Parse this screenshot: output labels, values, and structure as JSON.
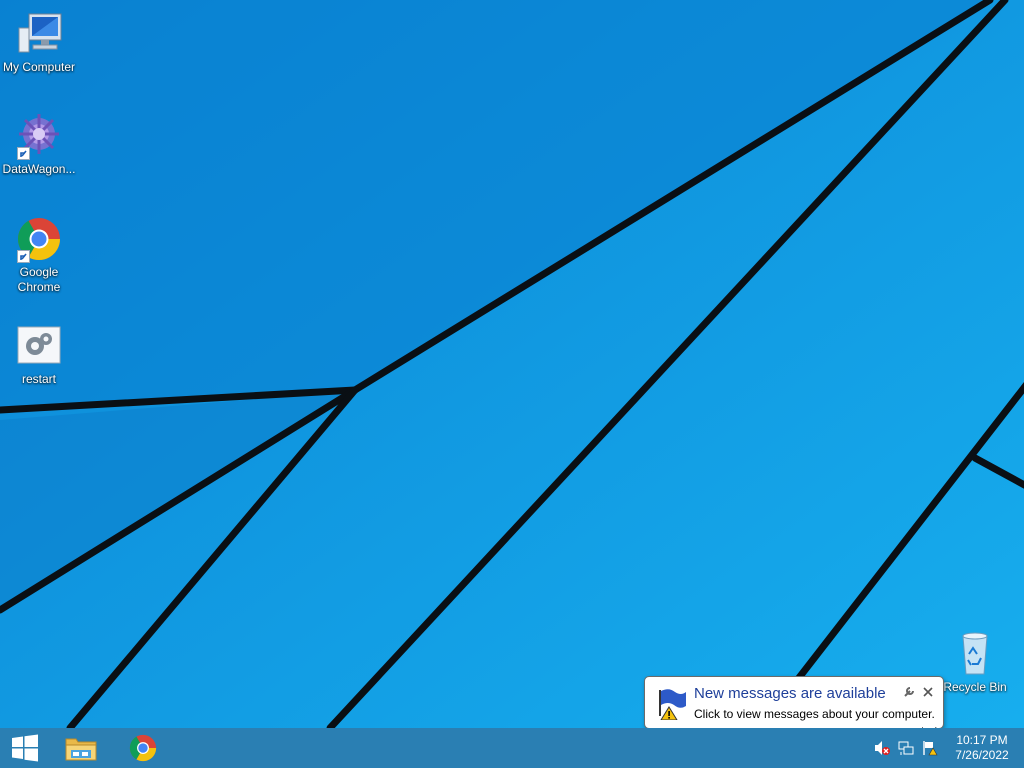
{
  "desktop": {
    "icons": [
      {
        "label": "My Computer",
        "icon": "computer-icon"
      },
      {
        "label": "DataWagon...",
        "icon": "datawagon-icon"
      },
      {
        "label": "Google Chrome",
        "icon": "chrome-icon"
      },
      {
        "label": "restart",
        "icon": "restart-icon"
      },
      {
        "label": "Recycle Bin",
        "icon": "recycle-bin-icon"
      }
    ]
  },
  "notification": {
    "title": "New messages are available",
    "text": "Click to view messages about your computer.",
    "icon": "flag-warning-icon"
  },
  "taskbar": {
    "pinned": [
      {
        "name": "start",
        "icon": "windows-logo-icon"
      },
      {
        "name": "file-explorer",
        "icon": "folder-icon"
      },
      {
        "name": "chrome",
        "icon": "chrome-icon"
      }
    ],
    "tray": [
      {
        "name": "volume-muted",
        "icon": "speaker-muted-icon"
      },
      {
        "name": "network",
        "icon": "network-icon"
      },
      {
        "name": "action-center",
        "icon": "flag-warning-icon"
      }
    ],
    "clock": {
      "time": "10:17 PM",
      "date": "7/26/2022"
    }
  },
  "colors": {
    "accent": "#0a8fdc",
    "taskbar": "#2a7fb3",
    "balloon_title": "#1e3f9a"
  }
}
